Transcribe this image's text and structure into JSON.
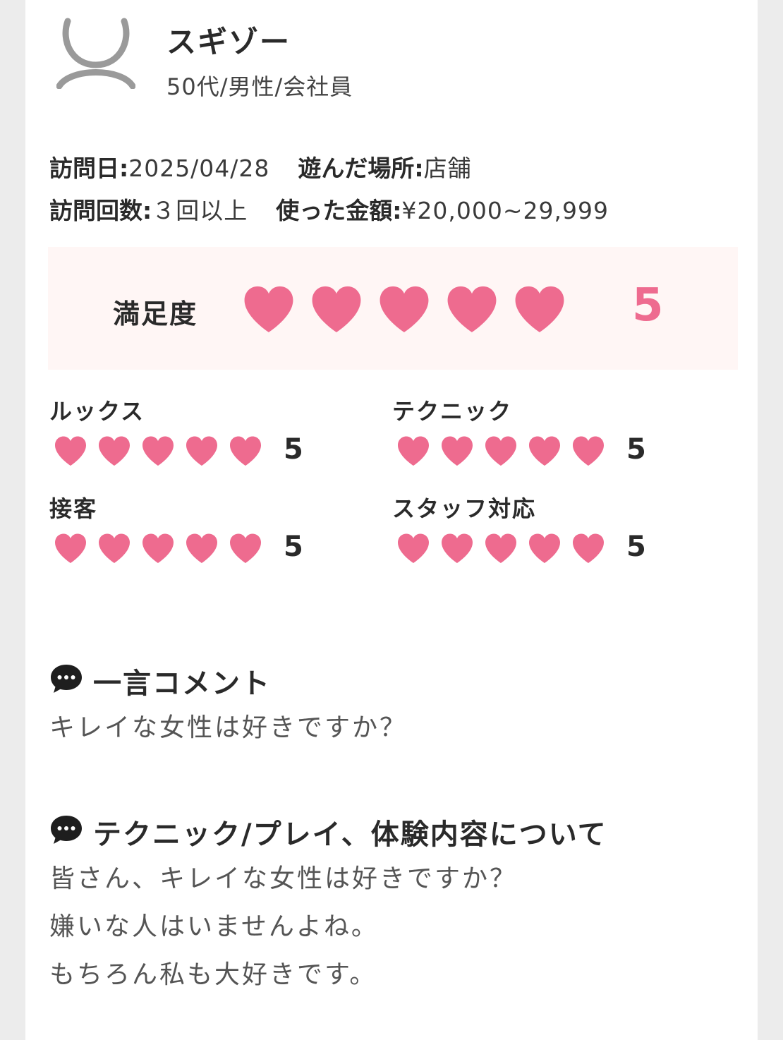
{
  "user": {
    "name": "スギゾー",
    "meta": "50代/男性/会社員"
  },
  "visit": {
    "date_label": "訪問日:",
    "date_value": "2025/04/28",
    "place_label": "遊んだ場所:",
    "place_value": "店舗",
    "count_label": "訪問回数:",
    "count_value": "３回以上",
    "amount_label": "使った金額:",
    "amount_value": "¥20,000~29,999"
  },
  "satisfaction": {
    "label": "満足度",
    "score": "5",
    "rating": 5,
    "max": 5
  },
  "categories": [
    {
      "label": "ルックス",
      "score": "5",
      "rating": 5
    },
    {
      "label": "テクニック",
      "score": "5",
      "rating": 5
    },
    {
      "label": "接客",
      "score": "5",
      "rating": 5
    },
    {
      "label": "スタッフ対応",
      "score": "5",
      "rating": 5
    }
  ],
  "comment": {
    "heading": "一言コメント",
    "text": "キレイな女性は好きですか？"
  },
  "technique": {
    "heading": "テクニック/プレイ、体験内容について",
    "lines": [
      "皆さん、キレイな女性は好きですか？",
      "嫌いな人はいませんよね。",
      "もちろん私も大好きです。"
    ]
  },
  "colors": {
    "heart": "#ee6b8f",
    "satisfaction_bg": "#fff6f5",
    "avatar": "#9a9a9a"
  },
  "icons": {
    "avatar": "person-outline-icon",
    "heart": "heart-icon",
    "comment": "speech-bubble-icon"
  }
}
